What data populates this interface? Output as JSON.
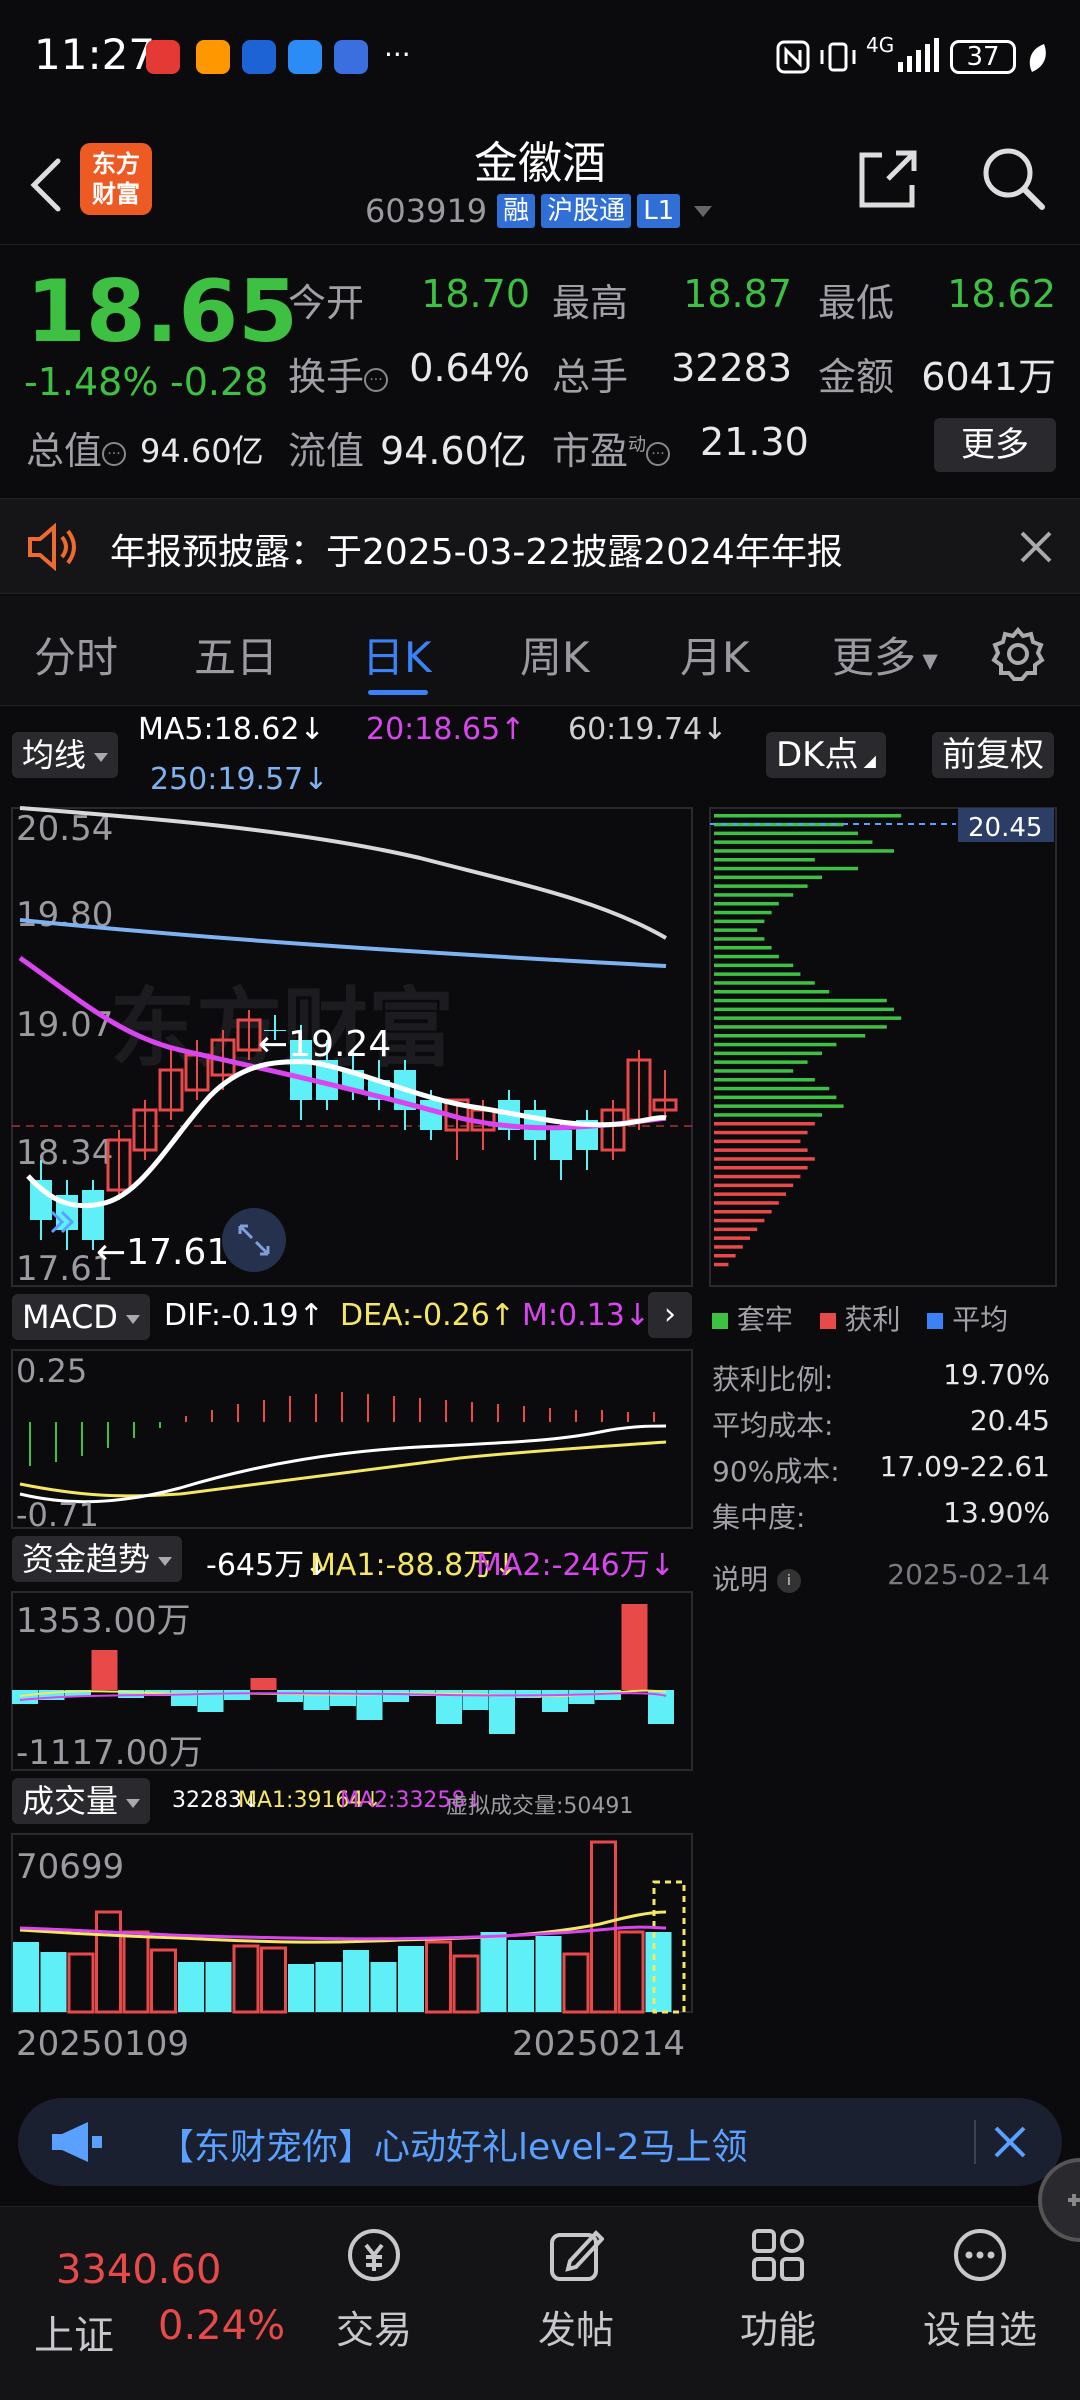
{
  "status_bar": {
    "time": "11:27",
    "network": "4G",
    "battery": "37",
    "more": "···"
  },
  "header": {
    "name": "金徽酒",
    "code": "603919",
    "tags": [
      "融",
      "沪股通",
      "L1"
    ],
    "logo_line1": "东方",
    "logo_line2": "财富"
  },
  "quote": {
    "price": "18.65",
    "change_pct": "-1.48%",
    "change_amt": "-0.28",
    "open_label": "今开",
    "open": "18.70",
    "high_label": "最高",
    "high": "18.87",
    "low_label": "最低",
    "low": "18.62",
    "turnover_label": "换手",
    "turnover": "0.64%",
    "volume_label": "总手",
    "volume": "32283",
    "amount_label": "金额",
    "amount": "6041万",
    "mktcap_label": "总值",
    "mktcap": "94.60亿",
    "float_label": "流值",
    "float": "94.60亿",
    "pe_label": "市盈",
    "pe_sup": "动",
    "pe": "21.30",
    "more": "更多"
  },
  "notice": {
    "text": "年报预披露：于2025-03-22披露2024年年报"
  },
  "tabs": [
    "分时",
    "五日",
    "日K",
    "周K",
    "月K",
    "更多"
  ],
  "kline": {
    "ma_button": "均线",
    "ma5": "MA5:18.62↓",
    "ma20": "20:18.65↑",
    "ma60": "60:19.74↓",
    "ma250": "250:19.57↓",
    "dk_button": "DK点",
    "adjust_button": "前复权",
    "y_labels": [
      "20.54",
      "19.80",
      "19.07",
      "18.34",
      "17.61"
    ],
    "high_mark": "←19.24",
    "low_mark": "←17.61",
    "watermark": "东方财富"
  },
  "macd": {
    "button": "MACD",
    "dif": "DIF:-0.19↑",
    "dea": "DEA:-0.26↑",
    "m": "M:0.13↓",
    "y_top": "0.25",
    "y_bottom": "-0.71"
  },
  "fund": {
    "button": "资金趋势",
    "val": "-645万↓",
    "ma1": "MA1:-88.8万↓",
    "ma2": "MA2:-246万↓",
    "y_top": "1353.00万",
    "y_bottom": "-1117.00万"
  },
  "vol": {
    "button": "成交量",
    "val": "32283↓",
    "ma1": "MA1:39164↓",
    "ma2": "MA2:33258↓",
    "virtual": "虚拟成交量:50491",
    "y_top": "70699"
  },
  "dates": {
    "start": "20250109",
    "end": "20250214"
  },
  "chips": {
    "price_tag": "20.45",
    "legend": [
      "套牢",
      "获利",
      "平均"
    ],
    "stats": [
      {
        "label": "获利比例:",
        "value": "19.70%"
      },
      {
        "label": "平均成本:",
        "value": "20.45"
      },
      {
        "label": "90%成本:",
        "value": "17.09-22.61"
      },
      {
        "label": "集中度:",
        "value": "13.90%"
      }
    ],
    "note_label": "说明",
    "note_date": "2025-02-14"
  },
  "promo": {
    "text": "【东财宠你】心动好礼level-2马上领"
  },
  "bottom_nav": {
    "index_value": "3340.60",
    "index_name": "上证",
    "index_change": "0.24%",
    "items": [
      "交易",
      "发帖",
      "功能",
      "设自选"
    ]
  },
  "colors": {
    "up": "#e84a4a",
    "down": "#3ec043",
    "accent": "#3b82f6",
    "ma5": "#ffffff",
    "ma20": "#d946ef",
    "ma60": "#d0d0d0",
    "ma250": "#7fb2f0",
    "cyan": "#5ef0f6"
  }
}
